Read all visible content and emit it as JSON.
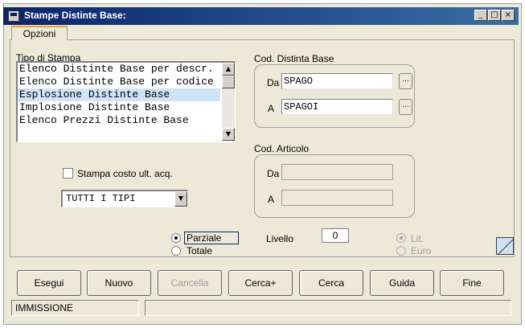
{
  "window": {
    "title": "Stampe Distinte Base:",
    "controls": {
      "minimize": "_",
      "maximize": "□",
      "close": "×"
    }
  },
  "tabs": [
    {
      "label": "Opzioni",
      "active": true
    }
  ],
  "tipo_stampa": {
    "label": "Tipo di Stampa",
    "items": [
      "Elenco Distinte Base per descr.",
      "Elenco Distinte Base per codice",
      "Esplosione Distinte Base",
      "Implosione Distinte Base",
      "Elenco Prezzi Distinte Base"
    ],
    "selected_index": 2
  },
  "cod_distinta_base": {
    "label": "Cod. Distinta Base",
    "da_label": "Da",
    "da_value": "SPAGO",
    "a_label": "A",
    "a_value": "SPAGOI",
    "lookup_label": "..."
  },
  "cod_articolo": {
    "label": "Cod. Articolo",
    "da_label": "Da",
    "da_value": "",
    "a_label": "A",
    "a_value": ""
  },
  "stampa_costo": {
    "label": "Stampa costo ult. acq.",
    "checked": false
  },
  "tipi_combo": {
    "value": "TUTTI I TIPI",
    "arrow": "▼"
  },
  "mode_radios": {
    "parziale": {
      "label": "Parziale",
      "checked": true
    },
    "totale": {
      "label": "Totale",
      "checked": false
    }
  },
  "livello": {
    "label": "Livello",
    "value": "0"
  },
  "currency_radios": {
    "lit": {
      "label": "Lit.",
      "checked": true
    },
    "euro": {
      "label": "Euro",
      "checked": false
    }
  },
  "buttons": {
    "esegui": "Esegui",
    "nuovo": "Nuovo",
    "cancella": "Cancella",
    "cerca_plus": "Cerca+",
    "cerca": "Cerca",
    "guida": "Guida",
    "fine": "Fine"
  },
  "status": {
    "mode": "IMMISSIONE",
    "message": ""
  },
  "colors": {
    "title_start": "#0a246a",
    "title_end": "#3a6ea5",
    "selection": "#cfe4f7",
    "tab_accent": "#f0a030"
  }
}
